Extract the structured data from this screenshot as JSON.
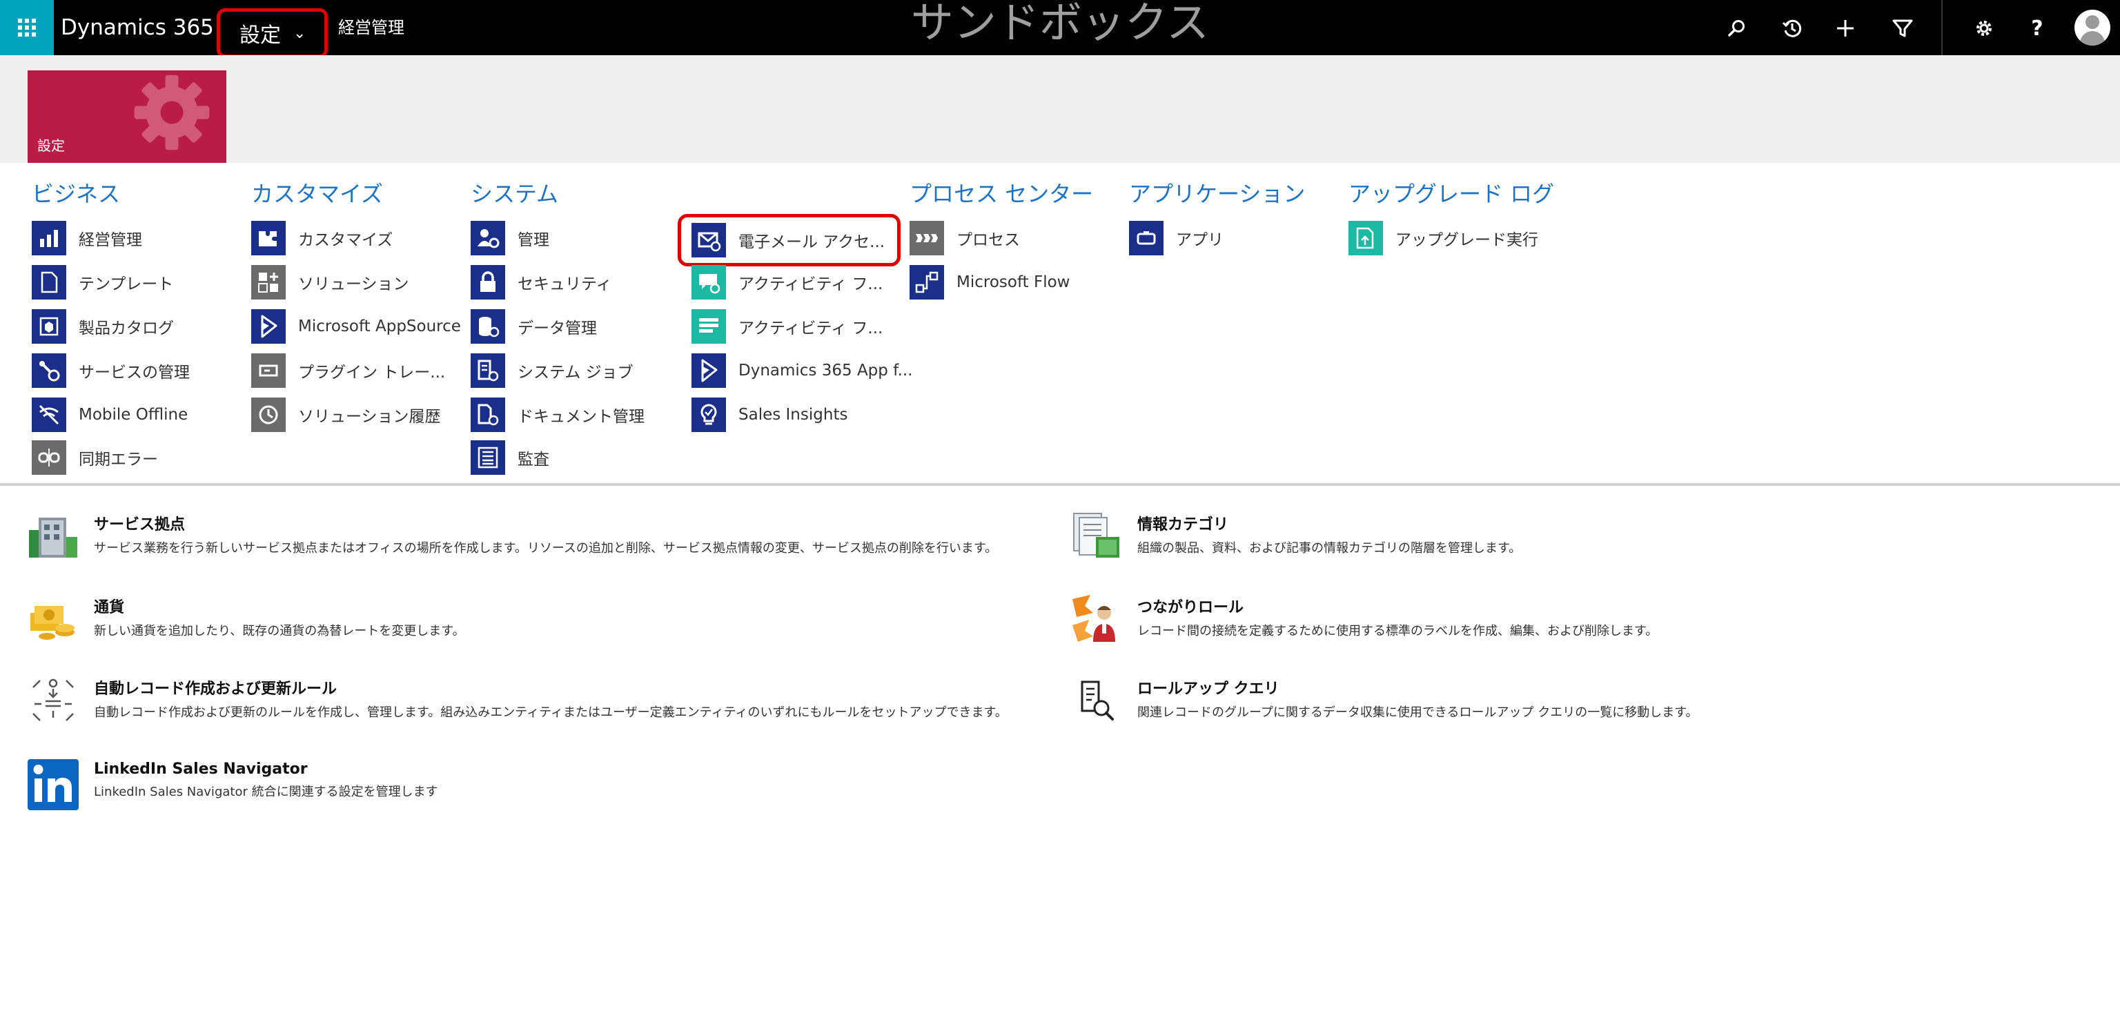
{
  "topbar": {
    "app_title": "Dynamics 365",
    "area": "設定",
    "breadcrumb": "経営管理",
    "environment": "サンドボックス",
    "icons": [
      "search-icon",
      "recent-icon",
      "new-icon",
      "filter-icon",
      "settings-icon",
      "help-icon",
      "user-avatar"
    ]
  },
  "tile": {
    "label": "設定",
    "color": "#b91d47"
  },
  "groups": {
    "business": {
      "title": "ビジネス",
      "items": [
        {
          "label": "経営管理",
          "icon": "business-management-icon"
        },
        {
          "label": "テンプレート",
          "icon": "templates-icon"
        },
        {
          "label": "製品カタログ",
          "icon": "product-catalog-icon"
        },
        {
          "label": "サービスの管理",
          "icon": "service-management-icon"
        },
        {
          "label": "Mobile Offline",
          "icon": "mobile-offline-icon"
        },
        {
          "label": "同期エラー",
          "icon": "sync-error-icon"
        }
      ]
    },
    "customization": {
      "title": "カスタマイズ",
      "items": [
        {
          "label": "カスタマイズ",
          "icon": "customizations-icon"
        },
        {
          "label": "ソリューション",
          "icon": "solutions-icon"
        },
        {
          "label": "Microsoft AppSource",
          "icon": "appsource-icon"
        },
        {
          "label": "プラグイン トレー...",
          "icon": "plugin-trace-icon"
        },
        {
          "label": "ソリューション履歴",
          "icon": "solution-history-icon"
        }
      ]
    },
    "system": {
      "title": "システム",
      "items": [
        {
          "label": "管理",
          "icon": "administration-icon"
        },
        {
          "label": "セキュリティ",
          "icon": "security-icon"
        },
        {
          "label": "データ管理",
          "icon": "data-management-icon"
        },
        {
          "label": "システム ジョブ",
          "icon": "system-jobs-icon"
        },
        {
          "label": "ドキュメント管理",
          "icon": "document-management-icon"
        },
        {
          "label": "監査",
          "icon": "auditing-icon"
        }
      ]
    },
    "system2": {
      "items": [
        {
          "label": "電子メール アクセ...",
          "icon": "email-configuration-icon",
          "highlighted": true
        },
        {
          "label": "アクティビティ フ...",
          "icon": "activity-feeds-config-icon"
        },
        {
          "label": "アクティビティ フ...",
          "icon": "activity-feeds-rules-icon"
        },
        {
          "label": "Dynamics 365 App f...",
          "icon": "dynamics-app-icon"
        },
        {
          "label": "Sales Insights",
          "icon": "sales-insights-icon"
        }
      ]
    },
    "process": {
      "title": "プロセス センター",
      "items": [
        {
          "label": "プロセス",
          "icon": "processes-icon"
        },
        {
          "label": "Microsoft Flow",
          "icon": "microsoft-flow-icon"
        }
      ]
    },
    "application": {
      "title": "アプリケーション",
      "items": [
        {
          "label": "アプリ",
          "icon": "apps-icon"
        }
      ]
    },
    "upgrade": {
      "title": "アップグレード ログ",
      "items": [
        {
          "label": "アップグレード実行",
          "icon": "upgrade-runs-icon"
        }
      ]
    }
  },
  "settings_list": {
    "left": [
      {
        "title": "サービス拠点",
        "desc": "サービス業務を行う新しいサービス拠点またはオフィスの場所を作成します。リソースの追加と削除、サービス拠点情報の変更、サービス拠点の削除を行います。",
        "icon": "sites-icon"
      },
      {
        "title": "通貨",
        "desc": "新しい通貨を追加したり、既存の通貨の為替レートを変更します。",
        "icon": "currencies-icon"
      },
      {
        "title": "自動レコード作成および更新ルール",
        "desc": "自動レコード作成および更新のルールを作成し、管理します。組み込みエンティティまたはユーザー定義エンティティのいずれにもルールをセットアップできます。",
        "icon": "record-creation-rules-icon"
      },
      {
        "title": "LinkedIn Sales Navigator",
        "desc": "LinkedIn Sales Navigator 統合に関連する設定を管理します",
        "icon": "linkedin-icon"
      }
    ],
    "right": [
      {
        "title": "情報カテゴリ",
        "desc": "組織の製品、資料、および記事の情報カテゴリの階層を管理します。",
        "icon": "subjects-icon"
      },
      {
        "title": "つながりロール",
        "desc": "レコード間の接続を定義するために使用する標準のラベルを作成、編集、および削除します。",
        "icon": "connection-roles-icon"
      },
      {
        "title": "ロールアップ クエリ",
        "desc": "関連レコードのグループに関するデータ収集に使用できるロールアップ クエリの一覧に移動します。",
        "icon": "rollup-queries-icon"
      }
    ]
  }
}
